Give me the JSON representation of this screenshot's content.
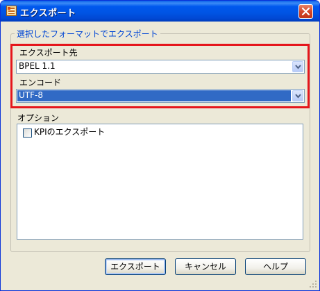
{
  "window": {
    "title": "エクスポート",
    "icon": "app-icon",
    "close_icon": "close-icon"
  },
  "group": {
    "caption": "選択したフォーマットでエクスポート",
    "export_to": {
      "label": "エクスポート先",
      "value": "BPEL 1.1"
    },
    "encoding": {
      "label": "エンコード",
      "value": "UTF-8"
    }
  },
  "options": {
    "label": "オプション",
    "items": [
      {
        "label": "KPIのエクスポート",
        "checked": false
      }
    ]
  },
  "buttons": {
    "export": "エクスポート",
    "cancel": "キャンセル",
    "help": "ヘルプ"
  },
  "colors": {
    "titlebar": "#0054e3",
    "highlight": "#e5151b",
    "selection": "#316ac5",
    "caption": "#0046d5"
  }
}
